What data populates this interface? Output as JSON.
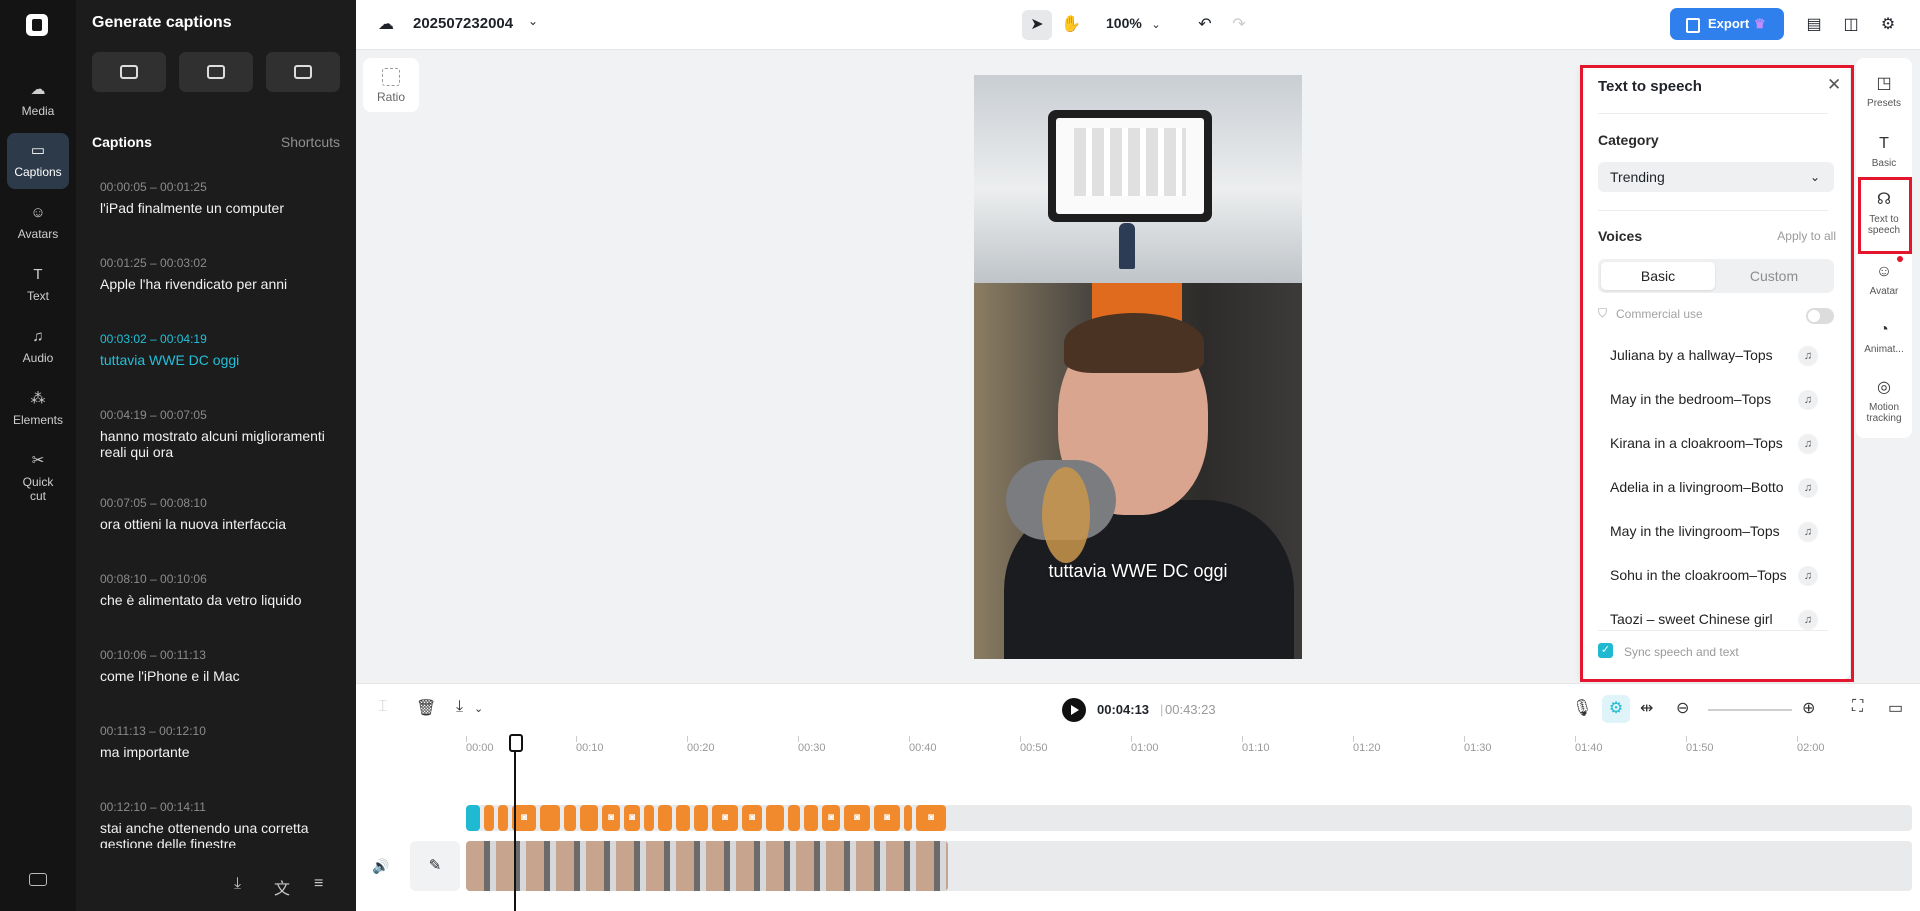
{
  "rail": {
    "items": [
      {
        "label": "Media",
        "icon": "cloud-upload-icon"
      },
      {
        "label": "Captions",
        "icon": "captions-icon",
        "active": true
      },
      {
        "label": "Avatars",
        "icon": "avatar-icon"
      },
      {
        "label": "Text",
        "icon": "text-icon"
      },
      {
        "label": "Audio",
        "icon": "music-note-icon"
      },
      {
        "label": "Elements",
        "icon": "elements-icon"
      },
      {
        "label": "Quick cut",
        "icon": "quick-cut-icon"
      }
    ]
  },
  "panel": {
    "title": "Generate captions",
    "section_title": "Captions",
    "shortcuts_label": "Shortcuts",
    "captions": [
      {
        "time": "00:00:05 – 00:01:25",
        "text": "l'iPad finalmente un computer"
      },
      {
        "time": "00:01:25 – 00:03:02",
        "text": "Apple l'ha rivendicato per anni"
      },
      {
        "time": "00:03:02 – 00:04:19",
        "text": "tuttavia WWE DC oggi",
        "active": true
      },
      {
        "time": "00:04:19 – 00:07:05",
        "text": "hanno mostrato alcuni miglioramenti reali qui ora"
      },
      {
        "time": "00:07:05 – 00:08:10",
        "text": "ora ottieni la nuova interfaccia"
      },
      {
        "time": "00:08:10 – 00:10:06",
        "text": "che è alimentato da vetro liquido"
      },
      {
        "time": "00:10:06 – 00:11:13",
        "text": "come l'iPhone e il Mac"
      },
      {
        "time": "00:11:13 – 00:12:10",
        "text": "ma importante"
      },
      {
        "time": "00:12:10 – 00:14:11",
        "text": "stai anche ottenendo una corretta gestione delle finestre"
      }
    ]
  },
  "topbar": {
    "project_title": "202507232004",
    "zoom": "100%",
    "export_label": "Export"
  },
  "canvas": {
    "ratio_label": "Ratio",
    "subtitle": "tuttavia WWE DC oggi"
  },
  "tts": {
    "title": "Text to speech",
    "category_label": "Category",
    "category_value": "Trending",
    "voices_label": "Voices",
    "apply_all": "Apply to all",
    "tab_basic": "Basic",
    "tab_custom": "Custom",
    "commercial": "Commercial use",
    "voices": [
      "Juliana by a hallway–Tops",
      "May in the bedroom–Tops",
      "Kirana in a cloakroom–Tops",
      "Adelia in a livingroom–Botto",
      "May in the livingroom–Tops",
      "Sohu in the cloakroom–Tops",
      "Taozi – sweet Chinese girl"
    ],
    "sync": "Sync speech and text"
  },
  "props": [
    {
      "label": "Presets",
      "icon": "presets-icon"
    },
    {
      "label": "Basic",
      "icon": "text-t-icon"
    },
    {
      "label": "Text to speech",
      "icon": "speech-icon"
    },
    {
      "label": "Avatar",
      "icon": "avatar-icon"
    },
    {
      "label": "Animat...",
      "icon": "animation-icon"
    },
    {
      "label": "Motion tracking",
      "icon": "motion-tracking-icon"
    }
  ],
  "timeline": {
    "current_time": "00:04:13",
    "separator": "|",
    "total_time": "00:43:23",
    "ruler": [
      "00:00",
      "00:10",
      "00:20",
      "00:30",
      "00:40",
      "00:50",
      "01:00",
      "01:10",
      "01:20",
      "01:30",
      "01:40",
      "01:50",
      "02:00"
    ]
  },
  "colors": {
    "accent": "#2f80ed",
    "active_caption": "#22c0d9",
    "highlight": "#e3162d",
    "caption_chip": "#f08a2d"
  }
}
